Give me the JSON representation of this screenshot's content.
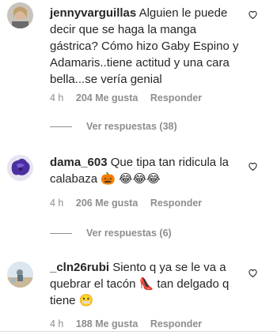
{
  "comments": [
    {
      "username": "jennyvarguillas",
      "text": "Alguien le puede decir que se haga la manga gástrica? Cómo hizo Gaby Espino y Adamaris..tiene actitud y una cara bella...se vería genial",
      "time": "4 h",
      "likes": "204 Me gusta",
      "reply": "Responder",
      "view_replies": "Ver respuestas (38)"
    },
    {
      "username": "dama_603",
      "text": "Que tipa tan ridicula la calabaza 🎃 😂😂😂",
      "time": "4 h",
      "likes": "206 Me gusta",
      "reply": "Responder",
      "view_replies": "Ver respuestas (6)"
    },
    {
      "username": "_cln26rubi",
      "text": "Siento q ya se le va a quebrar el tacón 👠 tan delgado q tiene 😬",
      "time": "4 h",
      "likes": "188 Me gusta",
      "reply": "Responder"
    }
  ]
}
